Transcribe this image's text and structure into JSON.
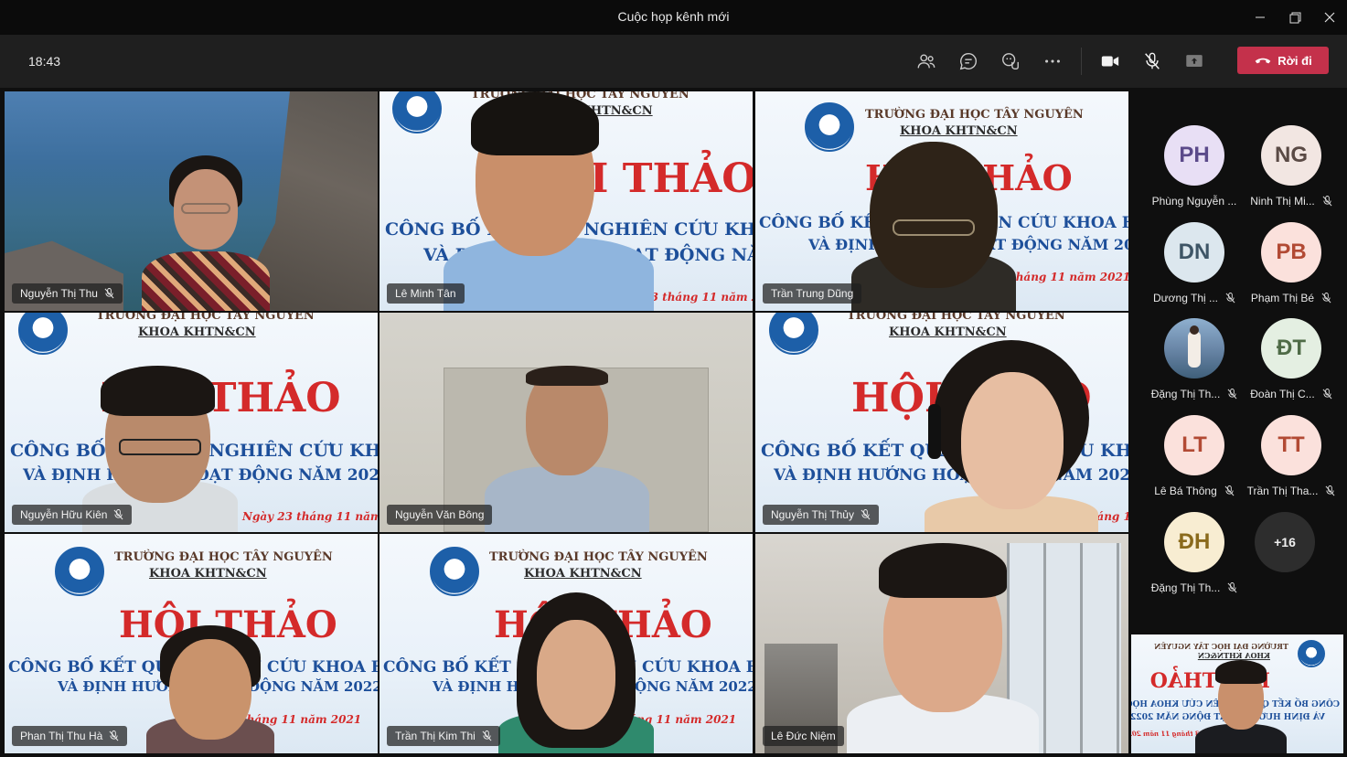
{
  "window": {
    "title": "Cuộc họp kênh mới"
  },
  "toolbar": {
    "time": "18:43",
    "leave_label": "Rời đi",
    "icons": [
      "people-icon",
      "chat-icon",
      "reactions-icon",
      "more-icon",
      "camera-icon",
      "mic-off-icon",
      "share-icon"
    ]
  },
  "banner": {
    "school": "TRƯỜNG ĐẠI HỌC TÂY NGUYÊN",
    "faculty": "KHOA KHTN&CN",
    "title": "HỘI THẢO",
    "line1": "CÔNG BỐ KẾT QUẢ NGHIÊN CỨU KHOA HỌC NĂM 2021",
    "line2": "VÀ ĐỊNH HƯỚNG HOẠT ĐỘNG NĂM 2022",
    "date": "Ngày 23 tháng 11 năm 2021"
  },
  "video_tiles": [
    {
      "name": "Nguyễn Thị Thu",
      "muted": true
    },
    {
      "name": "Lê Minh Tân",
      "muted": false
    },
    {
      "name": "Trần Trung Dũng",
      "muted": false
    },
    {
      "name": "Nguyễn Hữu Kiên",
      "muted": true
    },
    {
      "name": "Nguyễn Văn Bông",
      "muted": false
    },
    {
      "name": "Nguyễn Thị Thủy",
      "muted": true
    },
    {
      "name": "Phan Thị Thu Hà",
      "muted": true
    },
    {
      "name": "Trần Thị Kim Thi",
      "muted": true
    },
    {
      "name": "Lê Đức Niệm",
      "muted": false
    }
  ],
  "roster": [
    {
      "initials": "PH",
      "name": "Phùng Nguyễn ...",
      "muted": false,
      "bg": "#e8dff5",
      "fg": "#5b4a8a"
    },
    {
      "initials": "NG",
      "name": "Ninh Thị Mi...",
      "muted": true,
      "bg": "#f2e6e2",
      "fg": "#5a4a45"
    },
    {
      "initials": "DN",
      "name": "Dương Thị ...",
      "muted": true,
      "bg": "#dce7ee",
      "fg": "#3e5566"
    },
    {
      "initials": "PB",
      "name": "Phạm Thị Bé",
      "muted": true,
      "bg": "#fbe1dc",
      "fg": "#b24a34"
    },
    {
      "initials": "",
      "name": "Đặng Thị Th...",
      "muted": true,
      "bg": "#6a87a8",
      "fg": "#ffffff"
    },
    {
      "initials": "ĐT",
      "name": "Đoàn Thị C...",
      "muted": true,
      "bg": "#e4efe2",
      "fg": "#4f6b47"
    },
    {
      "initials": "LT",
      "name": "Lê Bá Thông",
      "muted": true,
      "bg": "#fbe1dc",
      "fg": "#b24a34"
    },
    {
      "initials": "TT",
      "name": "Trần Thị Tha...",
      "muted": true,
      "bg": "#fbe1dc",
      "fg": "#b24a34"
    },
    {
      "initials": "ĐH",
      "name": "Đặng Thị Th...",
      "muted": true,
      "bg": "#f8edd2",
      "fg": "#8a6a1c"
    }
  ],
  "overflow_count": "+16"
}
